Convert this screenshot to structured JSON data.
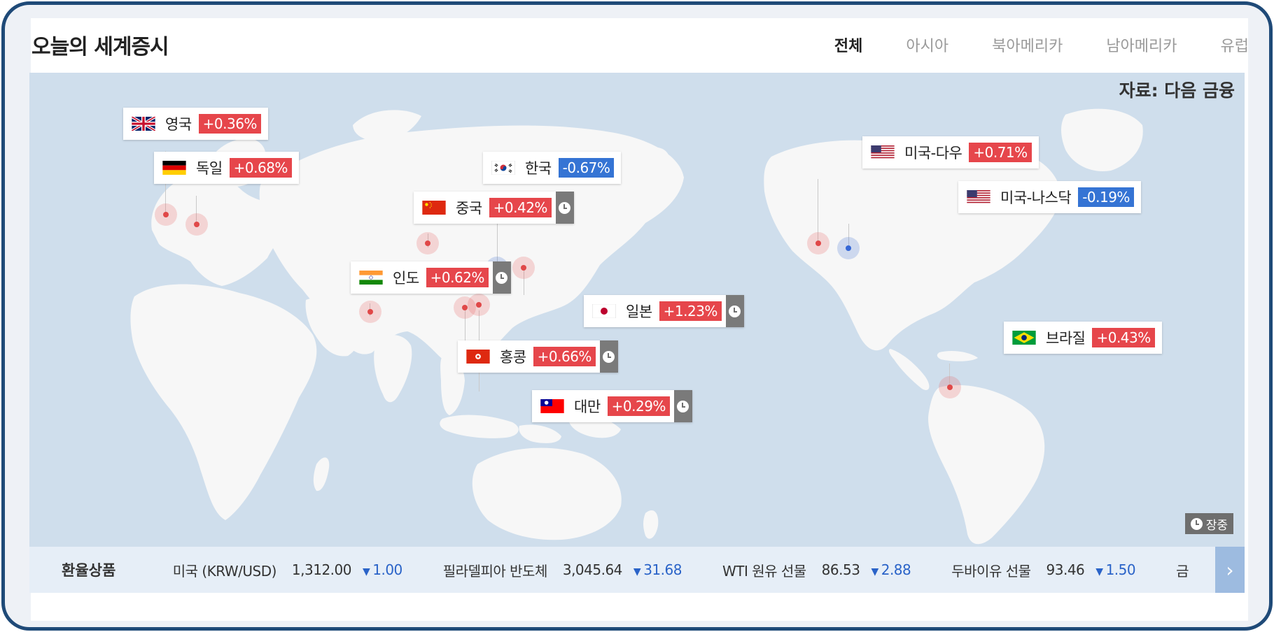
{
  "header": {
    "title": "오늘의 세계증시",
    "tabs": [
      {
        "label": "전체",
        "active": true
      },
      {
        "label": "아시아",
        "active": false
      },
      {
        "label": "북아메리카",
        "active": false
      },
      {
        "label": "남아메리카",
        "active": false
      },
      {
        "label": "유럽",
        "active": false
      }
    ]
  },
  "map": {
    "source": "자료: 다음 금융",
    "status_badge": "장중",
    "markets": [
      {
        "country": "영국",
        "change": "+0.36%",
        "direction": "up",
        "flag": "uk-flag-icon",
        "open": false
      },
      {
        "country": "독일",
        "change": "+0.68%",
        "direction": "up",
        "flag": "germany-flag-icon",
        "open": false
      },
      {
        "country": "한국",
        "change": "-0.67%",
        "direction": "down",
        "flag": "korea-flag-icon",
        "open": false
      },
      {
        "country": "중국",
        "change": "+0.42%",
        "direction": "up",
        "flag": "china-flag-icon",
        "open": true
      },
      {
        "country": "인도",
        "change": "+0.62%",
        "direction": "up",
        "flag": "india-flag-icon",
        "open": true
      },
      {
        "country": "일본",
        "change": "+1.23%",
        "direction": "up",
        "flag": "japan-flag-icon",
        "open": true
      },
      {
        "country": "홍콩",
        "change": "+0.66%",
        "direction": "up",
        "flag": "hongkong-flag-icon",
        "open": true
      },
      {
        "country": "대만",
        "change": "+0.29%",
        "direction": "up",
        "flag": "taiwan-flag-icon",
        "open": true
      },
      {
        "country": "미국-다우",
        "change": "+0.71%",
        "direction": "up",
        "flag": "usa-flag-icon",
        "open": false
      },
      {
        "country": "미국-나스닥",
        "change": "-0.19%",
        "direction": "down",
        "flag": "usa-flag-icon",
        "open": false
      },
      {
        "country": "브라질",
        "change": "+0.43%",
        "direction": "up",
        "flag": "brazil-flag-icon",
        "open": false
      }
    ]
  },
  "ticker": {
    "title": "환율상품",
    "items": [
      {
        "name": "미국 (KRW/USD)",
        "value": "1,312.00",
        "change": "1.00",
        "direction": "down"
      },
      {
        "name": "필라델피아 반도체",
        "value": "3,045.64",
        "change": "31.68",
        "direction": "down"
      },
      {
        "name": "WTI 원유 선물",
        "value": "86.53",
        "change": "2.88",
        "direction": "down"
      },
      {
        "name": "두바이유 선물",
        "value": "93.46",
        "change": "1.50",
        "direction": "down"
      },
      {
        "name": "금",
        "value": "",
        "change": "",
        "direction": ""
      }
    ],
    "next_icon": "chevron-right-icon"
  },
  "colors": {
    "up": "#e6464b",
    "down": "#3574d4",
    "map_bg": "#cfdeec",
    "land": "#f6f6f6",
    "frame": "#1f4a78"
  }
}
